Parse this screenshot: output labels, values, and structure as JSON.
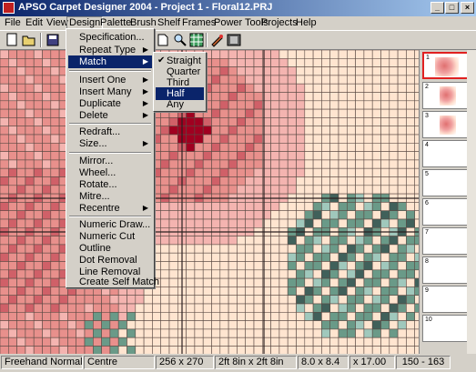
{
  "window": {
    "title": "APSO Carpet Designer 2004 - Project 1 - Floral12.PRJ"
  },
  "caption_buttons": {
    "minimize": "_",
    "maximize": "□",
    "close": "×"
  },
  "menubar": [
    "File",
    "Edit",
    "View",
    "Design",
    "Palette",
    "Brush",
    "Shelf",
    "Frames",
    "Power Tools",
    "Projects",
    "Help"
  ],
  "toolbar": {
    "icons": [
      "new-icon",
      "open-icon",
      "save-icon",
      "zoom-icon",
      "find-icon",
      "grid-icon",
      "palette-icon",
      "film-icon"
    ]
  },
  "design_menu": {
    "items": [
      {
        "label": "Specification...",
        "submenu": false
      },
      {
        "label": "Repeat Type",
        "submenu": true
      },
      {
        "label": "Match",
        "submenu": true,
        "highlighted": true
      },
      {
        "label": "Insert One",
        "submenu": true
      },
      {
        "label": "Insert Many",
        "submenu": true
      },
      {
        "label": "Duplicate",
        "submenu": true
      },
      {
        "label": "Delete",
        "submenu": true
      },
      {
        "label": "Redraft...",
        "submenu": false
      },
      {
        "label": "Size...",
        "submenu": true
      },
      {
        "label": "Mirror...",
        "submenu": false
      },
      {
        "label": "Wheel...",
        "submenu": false
      },
      {
        "label": "Rotate...",
        "submenu": false
      },
      {
        "label": "Mitre...",
        "submenu": false
      },
      {
        "label": "Recentre",
        "submenu": true
      },
      {
        "label": "Numeric Draw...",
        "submenu": false
      },
      {
        "label": "Numeric Cut",
        "submenu": false
      },
      {
        "label": "Outline",
        "submenu": false
      },
      {
        "label": "Dot Removal",
        "submenu": false
      },
      {
        "label": "Line Removal",
        "submenu": false
      },
      {
        "label": "Create Self Match",
        "submenu": false
      }
    ]
  },
  "match_submenu": {
    "items": [
      {
        "label": "Straight",
        "checked": true,
        "highlighted": false
      },
      {
        "label": "Quarter",
        "checked": false,
        "highlighted": false
      },
      {
        "label": "Third",
        "checked": false,
        "highlighted": false
      },
      {
        "label": "Half",
        "checked": false,
        "highlighted": true
      },
      {
        "label": "Any",
        "checked": false,
        "highlighted": false
      }
    ]
  },
  "thumbnails": [
    "1",
    "2",
    "3",
    "4",
    "5",
    "6",
    "7",
    "8",
    "9",
    "10"
  ],
  "status": {
    "brush": "Freehand Normal",
    "anchor": "Centre",
    "grid_size": "256 x 270",
    "dimensions": "2ft 8in x 2ft 8in",
    "ratio": "8.0 x 8.4",
    "zoom": "x 17.00",
    "position": "150 - 163"
  },
  "colors": {
    "background": "#ffe5d0",
    "light_pink": "#f4b4b0",
    "pink": "#e8908c",
    "rose": "#d06068",
    "dark_red": "#a00020",
    "teal": "#6a9a88",
    "dark_teal": "#40605a",
    "aqua": "#a0c8bc",
    "grid": "#5a4a44",
    "highlight": "#0a246a"
  }
}
